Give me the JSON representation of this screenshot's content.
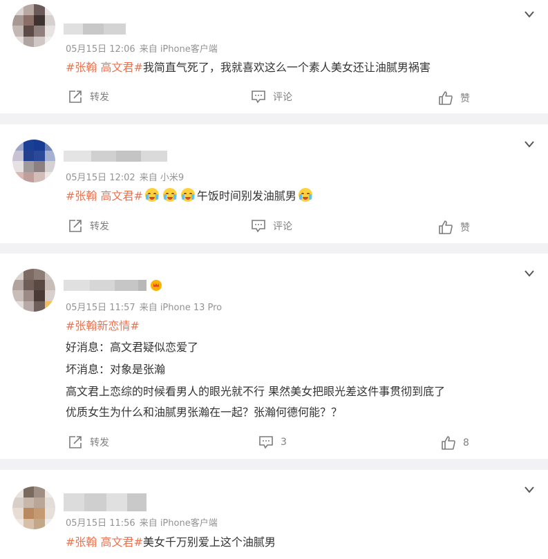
{
  "ui": {
    "repost_label": "转发",
    "comment_label": "评论",
    "like_label": "赞"
  },
  "colors": {
    "accent": "#eb7350",
    "meta": "#939393",
    "text": "#333333",
    "background": "#f2f2f5"
  },
  "posts": [
    {
      "time": "05月15日 12:06",
      "source": "来自 iPhone客户端",
      "tags": "#张翰 高文君#",
      "text": "我简直气死了，我就喜欢这么一个素人美女还让油腻男祸害",
      "comments": "评论",
      "likes": "赞"
    },
    {
      "time": "05月15日 12:02",
      "source": "来自 小米9",
      "tags": "#张翰 高文君#",
      "text": "午饭时间别发油腻男",
      "emoji": "crying-laughing-emoji",
      "comments": "评论",
      "likes": "赞"
    },
    {
      "time": "05月15日 11:57",
      "source": "来自 iPhone 13 Pro",
      "tags": "#张翰新恋情#",
      "lines": [
        "好消息：高文君疑似恋爱了",
        "坏消息：对象是张瀚",
        "高文君上恋综的时候看男人的眼光就不行 果然美女把眼光差这件事贯彻到底了",
        "优质女生为什么和油腻男张瀚在一起？张瀚何德何能？？"
      ],
      "comments": "3",
      "likes": "8"
    },
    {
      "time": "05月15日 11:56",
      "source": "来自 iPhone客户端",
      "tags": "#张翰 高文君#",
      "text": "美女千万别爱上这个油腻男"
    }
  ]
}
